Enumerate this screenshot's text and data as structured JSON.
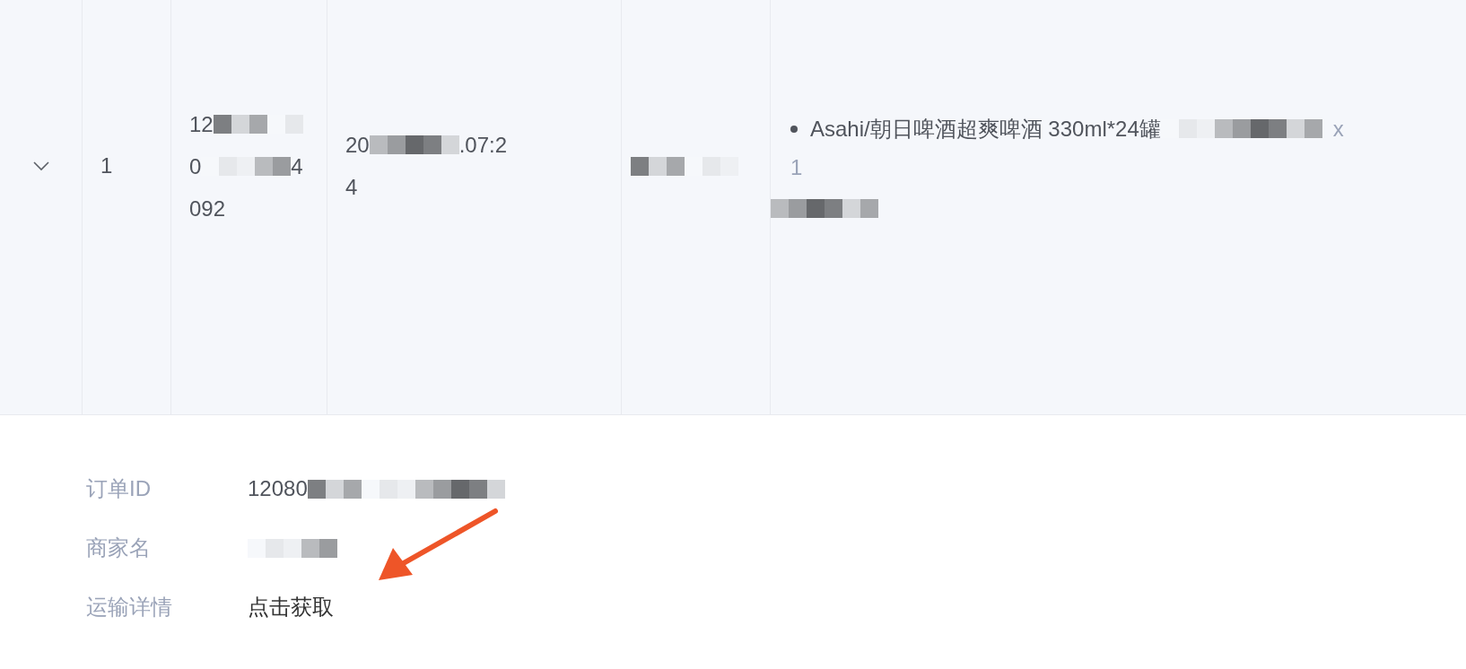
{
  "order_row": {
    "expanded": true,
    "index": "1",
    "order_id_lines": [
      [
        {
          "text": "12",
          "redacted_after": true
        }
      ],
      [
        {
          "text": "0",
          "redacted_after": true
        },
        {
          "text": "4",
          "redacted_after": false
        }
      ],
      [
        {
          "text": "092",
          "redacted_after": false
        }
      ]
    ],
    "time_lines": [
      [
        {
          "text": "20",
          "redacted_after": true
        },
        {
          "text": ".07:2",
          "redacted_after": false
        }
      ],
      [
        {
          "text": "4",
          "redacted_after": false
        }
      ]
    ],
    "products": [
      {
        "name": "Asahi/朝日啤酒超爽啤酒 330ml*24罐",
        "qty_mark": "x",
        "qty": "1"
      }
    ]
  },
  "details": [
    {
      "label": "订单ID",
      "value": "12080",
      "redacted": true,
      "kind": "text"
    },
    {
      "label": "商家名",
      "redacted": true,
      "kind": "text"
    },
    {
      "label": "运输详情",
      "value": "点击获取",
      "redacted": false,
      "kind": "link"
    }
  ]
}
